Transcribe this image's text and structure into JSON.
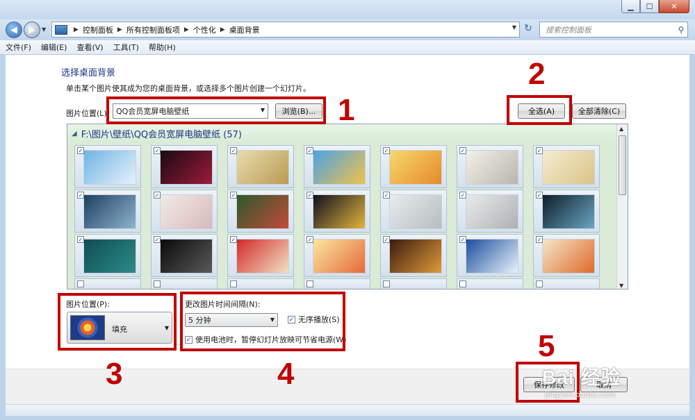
{
  "window": {
    "min_icon": "minimize-icon",
    "max_icon": "maximize-icon",
    "close_icon": "close-icon"
  },
  "nav": {
    "breadcrumb": [
      "控制面板",
      "所有控制面板项",
      "个性化",
      "桌面背景"
    ],
    "search_placeholder": "搜索控制面板"
  },
  "menu": [
    "文件(F)",
    "编辑(E)",
    "查看(V)",
    "工具(T)",
    "帮助(H)"
  ],
  "page": {
    "title": "选择桌面背景",
    "description": "单击某个图片使其成为您的桌面背景，或选择多个图片创建一个幻灯片。",
    "location_label": "图片位置(L):",
    "location_value": "QQ会员宽屏电脑壁纸",
    "browse_label": "浏览(B)...",
    "select_all_label": "全选(A)",
    "clear_all_label": "全部清除(C)"
  },
  "gallery": {
    "header": "F:\\图片\\壁纸\\QQ会员宽屏电脑壁纸 (57)",
    "check_mark": "✓",
    "thumbnails": [
      {
        "colors": [
          "#6fb4e6",
          "#e6f2fa"
        ]
      },
      {
        "colors": [
          "#1a0a12",
          "#9c1b3a"
        ]
      },
      {
        "colors": [
          "#e8dcae",
          "#b99b52"
        ]
      },
      {
        "colors": [
          "#4ba3e6",
          "#f1c14b"
        ]
      },
      {
        "colors": [
          "#f6d86b",
          "#e58a2a"
        ]
      },
      {
        "colors": [
          "#f2f0ea",
          "#b9b6ac"
        ]
      },
      {
        "colors": [
          "#f5ecd1",
          "#d9c487"
        ]
      },
      {
        "colors": [
          "#1c3f5e",
          "#8fb4cf"
        ]
      },
      {
        "colors": [
          "#f0ebe5",
          "#d8b9bc"
        ]
      },
      {
        "colors": [
          "#2b5a2a",
          "#c44a3a"
        ]
      },
      {
        "colors": [
          "#0e1020",
          "#e4b43a"
        ]
      },
      {
        "colors": [
          "#e8ecef",
          "#b7bcbf"
        ]
      },
      {
        "colors": [
          "#e9eaea",
          "#aeb0b2"
        ]
      },
      {
        "colors": [
          "#0d1d2a",
          "#6aa6c1"
        ]
      },
      {
        "colors": [
          "#0f4d54",
          "#2d8a88"
        ]
      },
      {
        "colors": [
          "#0a0a0a",
          "#5a5a5a"
        ]
      },
      {
        "colors": [
          "#d22a2a",
          "#f1e2c4"
        ]
      },
      {
        "colors": [
          "#fbe7a0",
          "#e56a3a"
        ]
      },
      {
        "colors": [
          "#3a1c0c",
          "#e09a3b"
        ]
      },
      {
        "colors": [
          "#1d4e9e",
          "#e9f2fa"
        ]
      },
      {
        "colors": [
          "#f3e6c9",
          "#e06a2a"
        ]
      }
    ]
  },
  "options": {
    "position_label": "图片位置(P):",
    "position_value": "填充",
    "interval_label": "更改图片时间间隔(N):",
    "interval_value": "5 分钟",
    "shuffle_label": "无序播放(S)",
    "battery_label": "使用电池时，暂停幻灯片放映可节省电源(W)"
  },
  "footer": {
    "save_label": "保存修改",
    "cancel_label": "取消"
  },
  "annotations": [
    "1",
    "2",
    "3",
    "4",
    "5"
  ],
  "watermark": {
    "main": "Bai 经验",
    "sub": "jingyan.baidu.com"
  },
  "colors": {
    "annotation": "#c00000",
    "title_blue": "#1e3287"
  }
}
